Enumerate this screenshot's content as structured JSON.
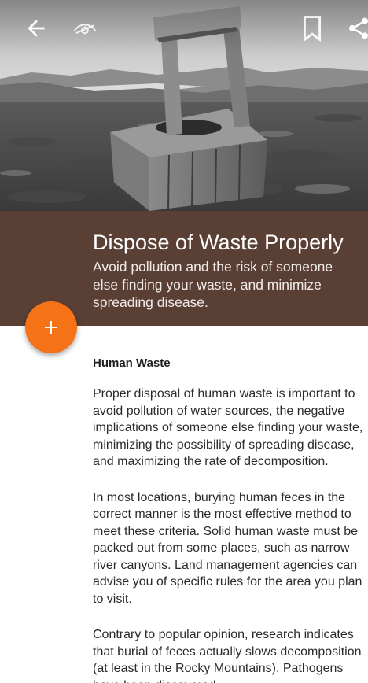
{
  "toolbar": {
    "back_icon": "arrow-left-icon",
    "view_icon": "eye-icon",
    "bookmark_icon": "bookmark-icon",
    "share_icon": "share-icon"
  },
  "header": {
    "title": "Dispose of Waste Properly",
    "subtitle": "Avoid pollution and the risk of someone else finding your waste, and minimize spreading disease."
  },
  "fab": {
    "label": "+",
    "icon": "plus-icon"
  },
  "article": {
    "section_heading": "Human Waste",
    "paragraphs": [
      "Proper disposal of human waste is important to avoid pollution of water sources, the negative implications of someone else finding your waste, minimizing the possibility of spreading disease, and maximizing the rate of decomposition.",
      "In most locations, burying human feces in the correct manner is the most effective method to meet these criteria. Solid human waste must be packed out from some places, such as narrow river canyons. Land management agencies can advise you of specific rules for the area you plan to visit.",
      "Contrary to popular opinion, research indicates that burial of feces actually slows decomposition (at least in the Rocky Mountains). Pathogens have been discovered"
    ]
  },
  "colors": {
    "band": "#5a3f35",
    "fab": "#f57316",
    "text": "#2b2b2b"
  }
}
